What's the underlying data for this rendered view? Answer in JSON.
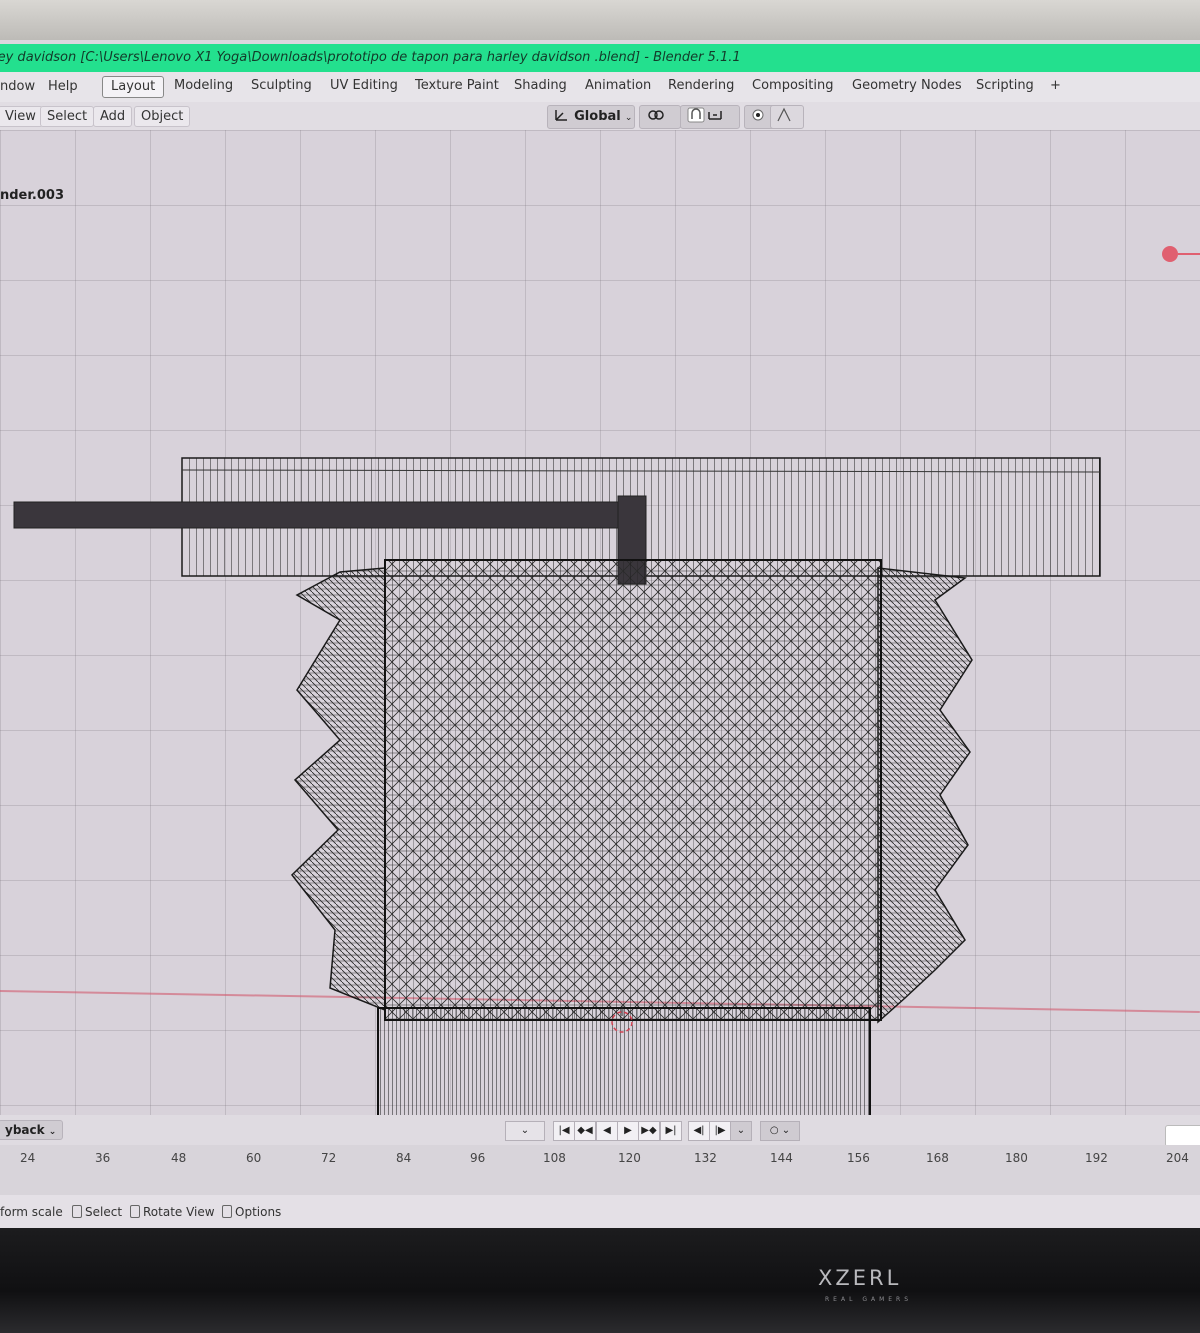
{
  "window": {
    "title": "ley davidson [C:\\Users\\Lenovo X1 Yoga\\Downloads\\prototipo de tapon para harley davidson .blend] - Blender 5.1.1"
  },
  "menu": {
    "items": [
      "ndow",
      "Help"
    ],
    "workspaces": [
      "Layout",
      "Modeling",
      "Sculpting",
      "UV Editing",
      "Texture Paint",
      "Shading",
      "Animation",
      "Rendering",
      "Compositing",
      "Geometry Nodes",
      "Scripting"
    ],
    "active_workspace": "Layout",
    "add_tab": "+"
  },
  "viewport_header": {
    "menus": [
      "View",
      "Select",
      "Add",
      "Object"
    ],
    "transform_orientation": "Global",
    "active_object": "nder.003"
  },
  "timeline": {
    "playback_label": "yback",
    "frame_ticks": [
      "24",
      "36",
      "48",
      "60",
      "72",
      "84",
      "96",
      "108",
      "120",
      "132",
      "144",
      "156",
      "168",
      "180",
      "192",
      "204"
    ]
  },
  "statusbar": {
    "items": [
      "form scale",
      "Select",
      "Rotate View",
      "Options"
    ]
  },
  "monitor": {
    "brand": "XZERL",
    "brand_sub": "REAL GAMERS"
  },
  "colors": {
    "title_bar": "#23e08e",
    "viewport_bg": "#d8d2da",
    "mesh_wire": "#1a1a1a"
  }
}
